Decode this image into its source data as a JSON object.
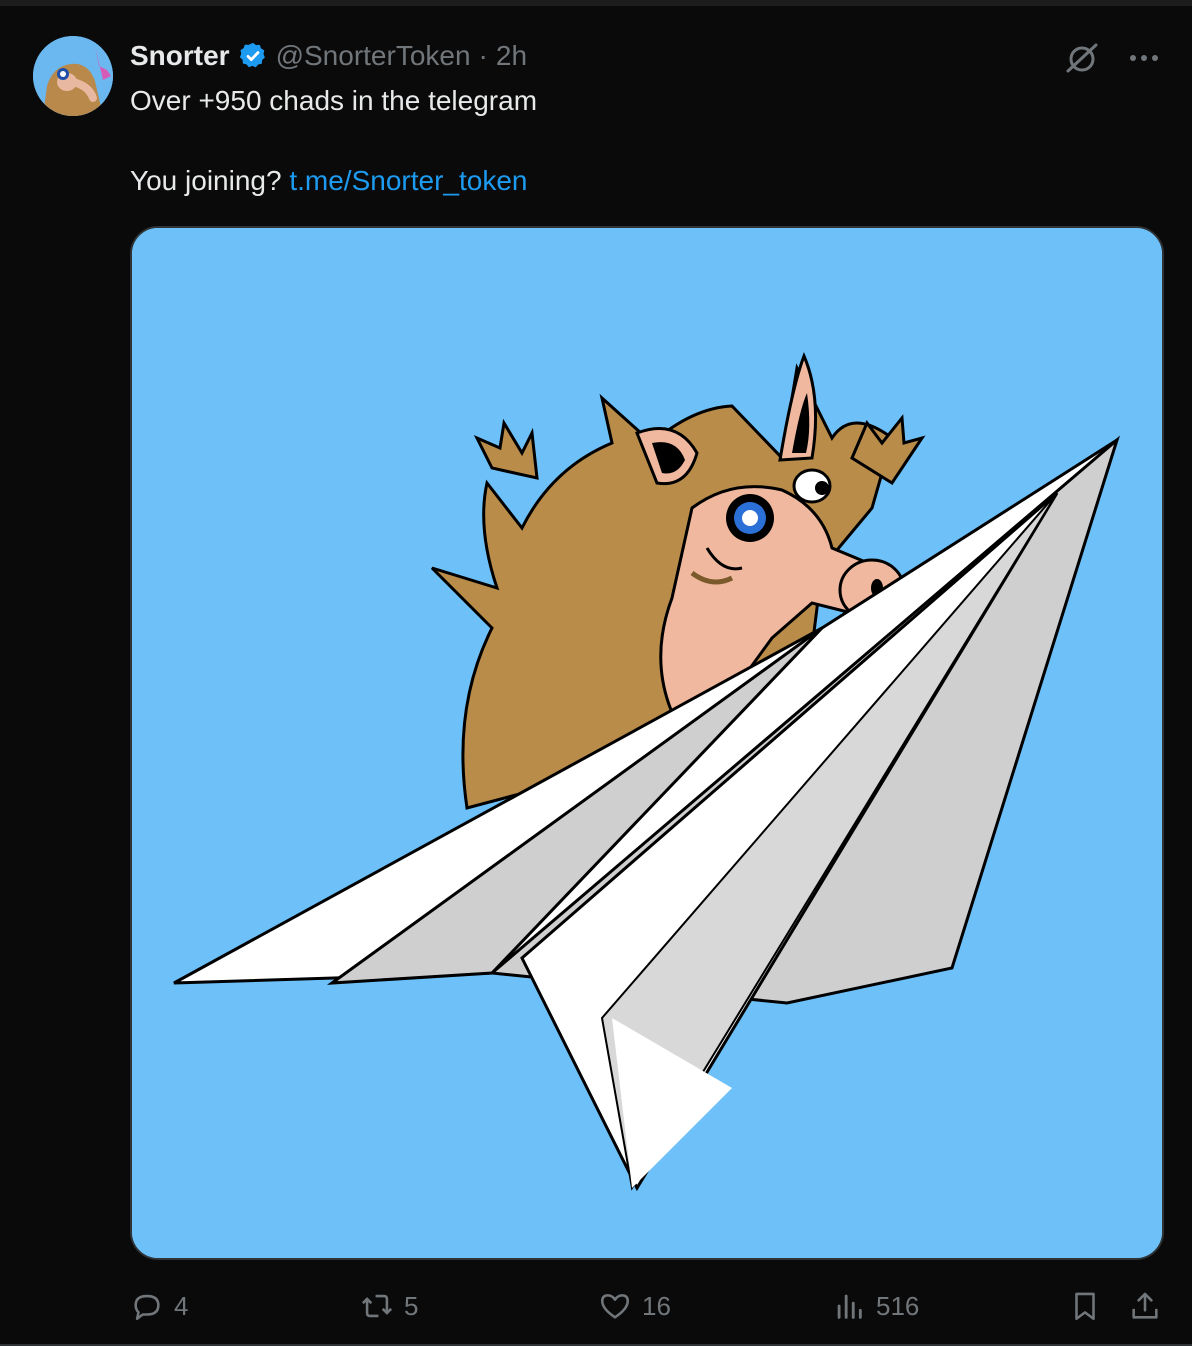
{
  "post": {
    "author_name": "Snorter",
    "handle": "@SnorterToken",
    "separator": "·",
    "time": "2h",
    "text_line1": "Over +950  chads in the telegram",
    "text_line2": "You joining?",
    "link_text": "t.me/Snorter_token"
  },
  "icons": {
    "verified": "verified-badge-icon",
    "grok": "grok-icon",
    "more": "more-icon",
    "reply": "reply-icon",
    "repost": "repost-icon",
    "like": "like-icon",
    "views": "views-icon",
    "bookmark": "bookmark-icon",
    "share": "share-icon"
  },
  "metrics": {
    "replies": "4",
    "reposts": "5",
    "likes": "16",
    "views": "516"
  },
  "colors": {
    "background": "#000000",
    "text": "#e7e9ea",
    "muted": "#71767b",
    "link": "#1d9bf0",
    "verified": "#1d9bf0",
    "media_bg": "#6dc0f8"
  }
}
